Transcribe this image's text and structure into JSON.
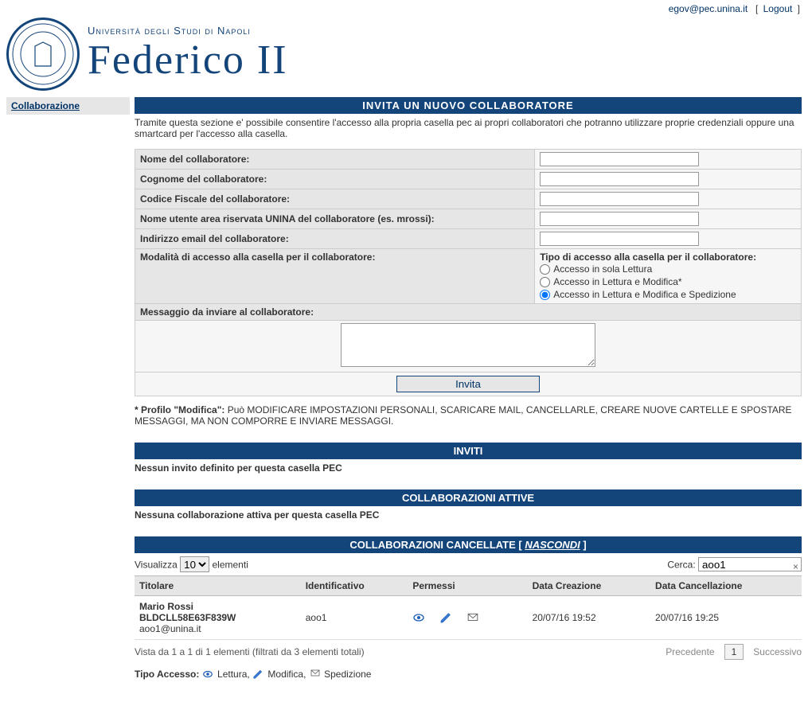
{
  "topbar": {
    "email": "egov@pec.unina.it",
    "logout": "Logout"
  },
  "university": {
    "subtitle": "Università degli Studi di Napoli",
    "title": "Federico II"
  },
  "sidebar": {
    "items": [
      {
        "label": "Collaborazione"
      }
    ]
  },
  "invite": {
    "title": "INVITA UN NUOVO COLLABORATORE",
    "intro": "Tramite questa sezione e' possibile consentire l'accesso alla propria casella pec ai propri collaboratori che potranno utilizzare proprie credenziali oppure una smartcard per l'accesso alla casella.",
    "labels": {
      "nome": "Nome del collaboratore:",
      "cognome": "Cognome del collaboratore:",
      "cf": "Codice Fiscale del collaboratore:",
      "username": "Nome utente area riservata UNINA del collaboratore (es. mrossi):",
      "email": "Indirizzo email del collaboratore:",
      "modalita": "Modalità di accesso alla casella per il collaboratore:",
      "tipo": "Tipo di accesso alla casella per il collaboratore:",
      "radio_lettura": "Accesso in sola Lettura",
      "radio_modifica": "Accesso in Lettura e Modifica*",
      "radio_spedizione": "Accesso in Lettura e Modifica e Spedizione",
      "messaggio": "Messaggio da inviare al collaboratore:",
      "invita_btn": "Invita"
    },
    "fields": {
      "nome": "",
      "cognome": "",
      "cf": "",
      "username": "",
      "email": "",
      "messaggio": ""
    },
    "note_prefix": "* Profilo \"Modifica\":",
    "note": " Può MODIFICARE IMPOSTAZIONI PERSONALI, SCARICARE MAIL, CANCELLARLE, CREARE NUOVE CARTELLE E SPOSTARE MESSAGGI, MA NON COMPORRE E INVIARE MESSAGGI."
  },
  "sections": {
    "inviti_title": "INVITI",
    "inviti_msg": "Nessun invito definito per questa casella PEC",
    "attive_title": "COLLABORAZIONI ATTIVE",
    "attive_msg": "Nessuna collaborazione attiva per questa casella PEC",
    "cancellate_title_prefix": "COLLABORAZIONI CANCELLATE [ ",
    "cancellate_title_link": "NASCONDI",
    "cancellate_title_suffix": " ]"
  },
  "table": {
    "visualizza_label": "Visualizza",
    "visualizza_value": "10",
    "elementi_label": "elementi",
    "cerca_label": "Cerca:",
    "cerca_value": "aoo1",
    "headers": {
      "titolare": "Titolare",
      "identificativo": "Identificativo",
      "permessi": "Permessi",
      "creazione": "Data Creazione",
      "cancellazione": "Data Cancellazione"
    },
    "rows": [
      {
        "titolare_name": "Mario Rossi",
        "titolare_cf": "BLDCLL58E63F839W",
        "titolare_email": "aoo1@unina.it",
        "identificativo": "aoo1",
        "creazione": "20/07/16 19:52",
        "cancellazione": "20/07/16 19:25"
      }
    ],
    "footer_info": "Vista da 1 a 1 di 1 elementi (filtrati da 3 elementi totali)",
    "pager": {
      "precedente": "Precedente",
      "page": "1",
      "successivo": "Successivo"
    }
  },
  "legend": {
    "prefix": "Tipo Accesso: ",
    "lettura": " Lettura, ",
    "modifica": " Modifica, ",
    "spedizione": " Spedizione"
  }
}
